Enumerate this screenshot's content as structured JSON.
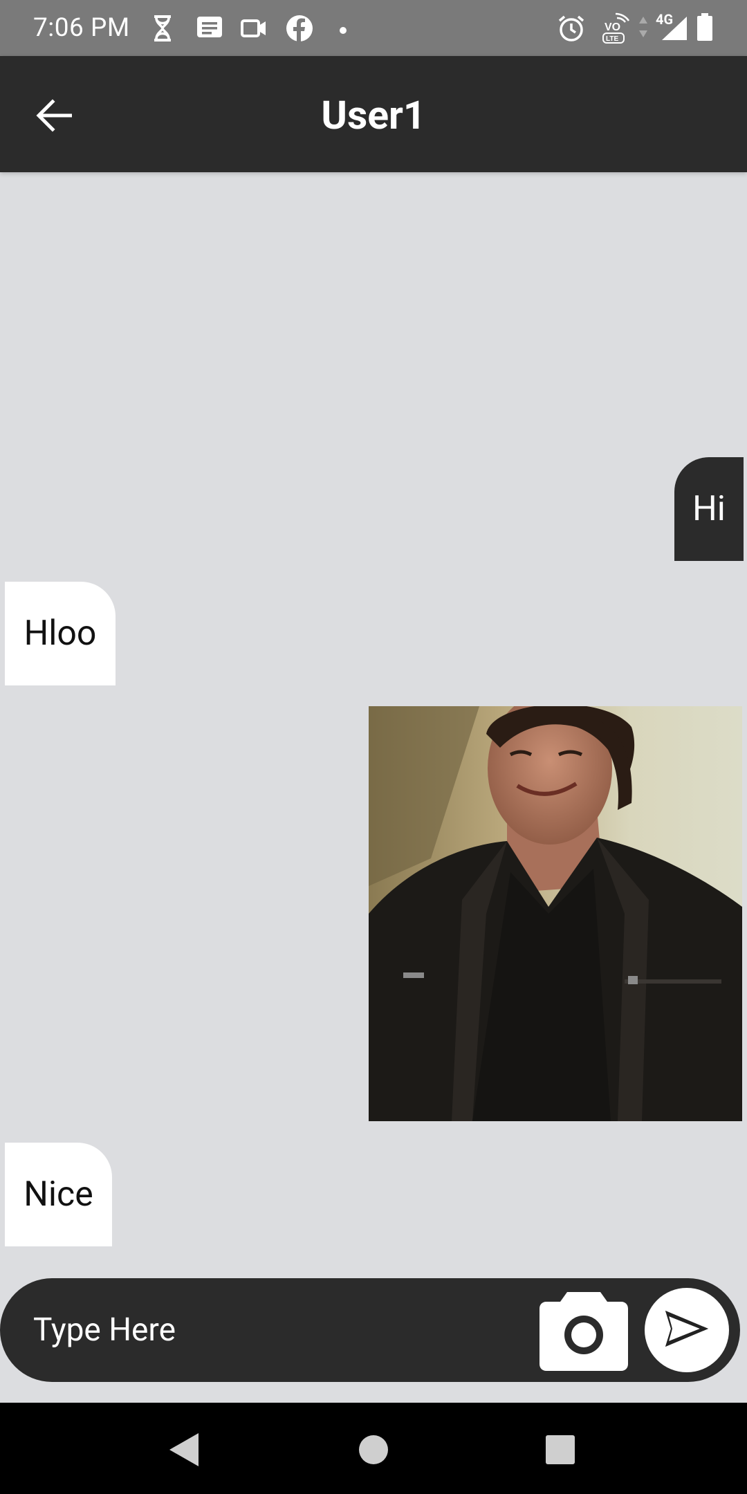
{
  "status_bar": {
    "time": "7:06 PM",
    "network": "4G",
    "icons": [
      "hourglass-icon",
      "message-icon",
      "video-icon",
      "facebook-icon",
      "dot-icon",
      "alarm-icon",
      "volte-icon",
      "data-arrows-icon",
      "signal-icon",
      "battery-icon"
    ]
  },
  "app_bar": {
    "title": "User1",
    "back_icon": "arrow-left-icon"
  },
  "messages": [
    {
      "type": "sent",
      "text": "Hi"
    },
    {
      "type": "received",
      "text": "Hloo"
    },
    {
      "type": "sent-image",
      "text": ""
    },
    {
      "type": "received",
      "text": "Nice"
    }
  ],
  "composer": {
    "placeholder": "Type Here",
    "camera_icon": "camera-icon",
    "send_icon": "send-icon"
  },
  "nav_bar": {
    "icons": [
      "back-triangle-icon",
      "home-circle-icon",
      "recents-square-icon"
    ]
  },
  "colors": {
    "header": "#2b2b2b",
    "background": "#dcdde0",
    "status_bar": "#7a7a7a",
    "received_bubble": "#ffffff",
    "sent_bubble": "#2b2b2b"
  }
}
